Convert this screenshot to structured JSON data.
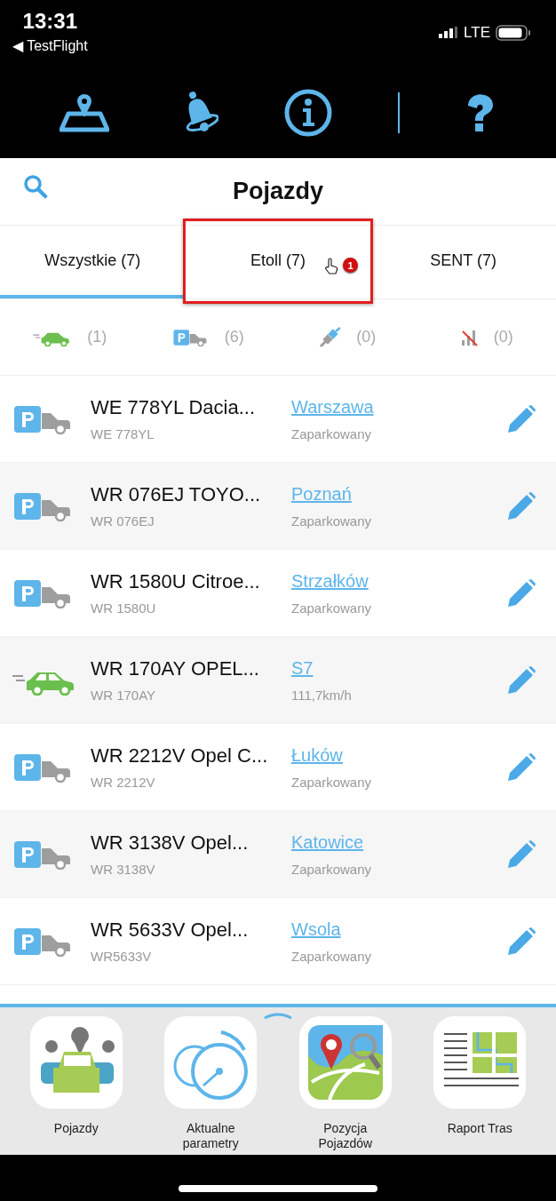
{
  "status_bar": {
    "time": "13:31",
    "back_app": "◀ TestFlight",
    "network": "LTE"
  },
  "toolbar": [
    {
      "kind": "map"
    },
    {
      "kind": "bell"
    },
    {
      "kind": "info"
    },
    {
      "kind": "help"
    }
  ],
  "header": {
    "title": "Pojazdy"
  },
  "tabs": [
    {
      "label": "Wszystkie (7)",
      "selected": true
    },
    {
      "label": "Etoll (7)",
      "selected": false
    },
    {
      "label": "SENT (7)",
      "selected": false
    }
  ],
  "annotation": {
    "badge": "1"
  },
  "filters": [
    {
      "kind": "moving",
      "count": "(1)"
    },
    {
      "kind": "parked",
      "count": "(6)"
    },
    {
      "kind": "plug",
      "count": "(0)"
    },
    {
      "kind": "nosignal",
      "count": "(0)"
    }
  ],
  "vehicles": [
    {
      "kind": "parked",
      "name": "WE 778YL Dacia...",
      "plate": "WE 778YL",
      "location": "Warszawa",
      "status": "Zaparkowany"
    },
    {
      "kind": "parked",
      "name": "WR 076EJ TOYO...",
      "plate": "WR 076EJ",
      "location": "Poznań",
      "status": "Zaparkowany"
    },
    {
      "kind": "parked",
      "name": "WR 1580U Citroe...",
      "plate": "WR 1580U",
      "location": "Strzałków",
      "status": "Zaparkowany"
    },
    {
      "kind": "moving",
      "name": "WR 170AY OPEL...",
      "plate": "WR 170AY",
      "location": "S7",
      "status": "111,7km/h"
    },
    {
      "kind": "parked",
      "name": "WR 2212V Opel C...",
      "plate": "WR 2212V",
      "location": "Łuków",
      "status": "Zaparkowany"
    },
    {
      "kind": "parked",
      "name": "WR 3138V Opel...",
      "plate": "WR 3138V",
      "location": "Katowice",
      "status": "Zaparkowany"
    },
    {
      "kind": "parked",
      "name": "WR 5633V Opel...",
      "plate": "WR5633V",
      "location": "Wsola",
      "status": "Zaparkowany"
    }
  ],
  "bottom_nav": [
    {
      "kind": "vehicles",
      "label": "Pojazdy"
    },
    {
      "kind": "gauges",
      "label": "Aktualne parametry"
    },
    {
      "kind": "map",
      "label": "Pozycja Pojazdów"
    },
    {
      "kind": "report",
      "label": "Raport Tras"
    }
  ]
}
